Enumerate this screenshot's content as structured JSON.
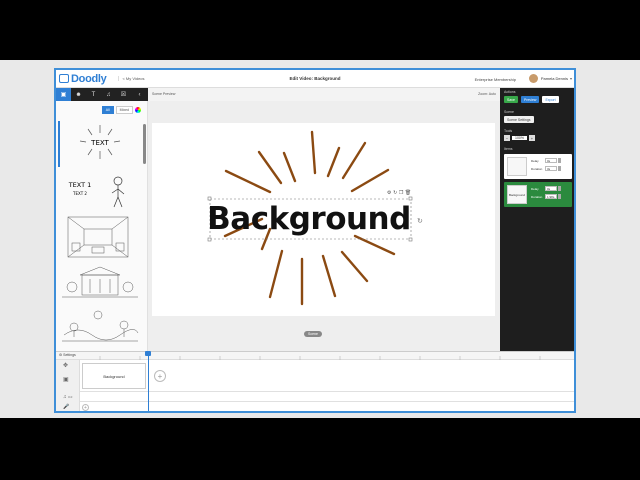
{
  "app": {
    "brand": "Doodly",
    "my_videos": "< My Videos",
    "title": "Edit Video: Background",
    "membership": "Enterprise Membership",
    "user_name": "Pamela Dennis"
  },
  "left_panel": {
    "tools": [
      "image-icon",
      "people-icon",
      "text-icon",
      "music-icon",
      "cart-icon"
    ],
    "filters": {
      "all": "All",
      "mixed": "Mixed"
    },
    "scenes": [
      {
        "text": "TEXT"
      },
      {
        "text_1": "TEXT 1",
        "text_2": "TEXT 2"
      }
    ]
  },
  "canvas": {
    "left_label": "Scene Preview",
    "right_label": "Zoom: Auto",
    "stage_text": "Background",
    "scene_pill": "Scene"
  },
  "right_panel": {
    "actions_heading": "Actions",
    "save_label": "Save",
    "preview_label": "Preview",
    "export_label": "Export",
    "scene_heading": "Scene",
    "scene_settings_label": "Scene Settings",
    "tools_heading": "Tools",
    "zoom_value": "100%",
    "items_heading": "Items",
    "items": [
      {
        "thumb": "",
        "delay_label": "Delay",
        "delay": "0s",
        "duration_label": "Duration",
        "duration": "3s"
      },
      {
        "thumb": "Background",
        "delay_label": "Delay",
        "delay": "0s",
        "duration_label": "Duration",
        "duration": "1.98s"
      }
    ]
  },
  "timeline": {
    "settings_label": "Settings",
    "clip_label": "Background",
    "audio_value": "0.0"
  },
  "colors": {
    "brand_blue": "#2f7fd4",
    "sunburst_stroke": "#8b4a12",
    "selected_item": "#2b8a3e"
  }
}
